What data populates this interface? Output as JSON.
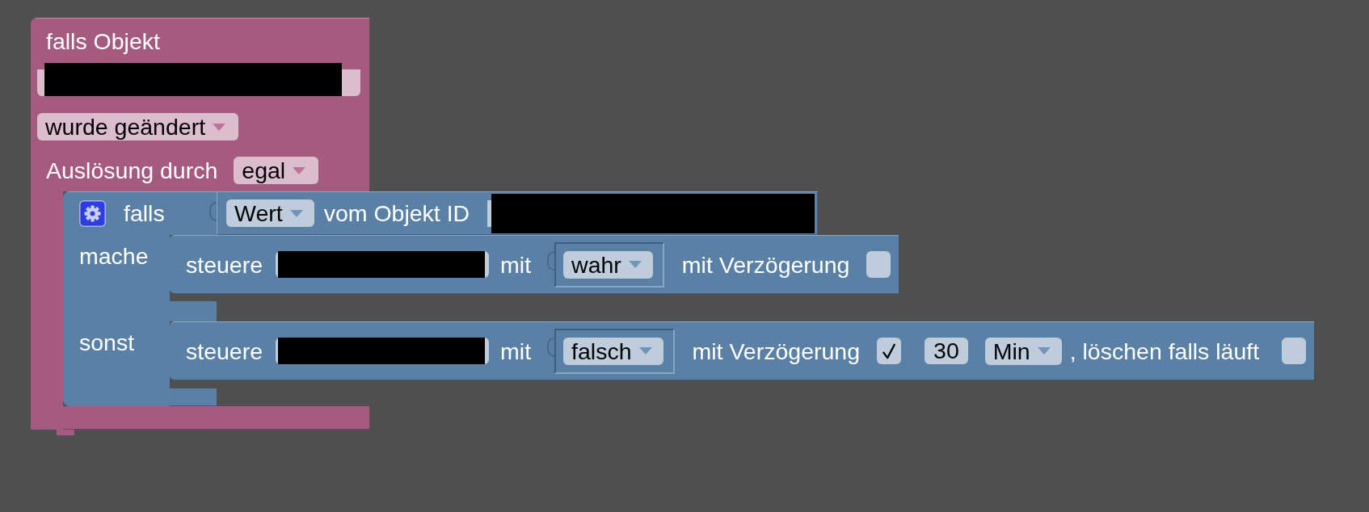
{
  "event_block": {
    "title": "falls Objekt",
    "object_id": {
      "redacted": true
    },
    "event": "wurde geändert",
    "trigger_label": "Auslösung durch",
    "trigger": "egal",
    "if_block": {
      "label": "falls",
      "value_block": {
        "mode": "Wert",
        "label": "vom Objekt ID",
        "object_id": {
          "redacted": true
        }
      },
      "branches": [
        {
          "label": "mache",
          "action": {
            "label": "steuere",
            "object_id": {
              "redacted": true
            },
            "with_label": "mit",
            "value": "wahr",
            "delay_label": "mit Verzögerung",
            "delay": {
              "checked": false
            }
          }
        },
        {
          "label": "sonst",
          "action": {
            "label": "steuere",
            "object_id": {
              "redacted": true
            },
            "with_label": "mit",
            "value": "falsch",
            "delay_label": "mit Verzögerung",
            "delay": {
              "checked": true
            },
            "delay_time": "30",
            "delay_unit": "Min",
            "clear_label": ", löschen falls läuft",
            "clear_running": {
              "checked": false
            }
          }
        }
      ]
    }
  }
}
